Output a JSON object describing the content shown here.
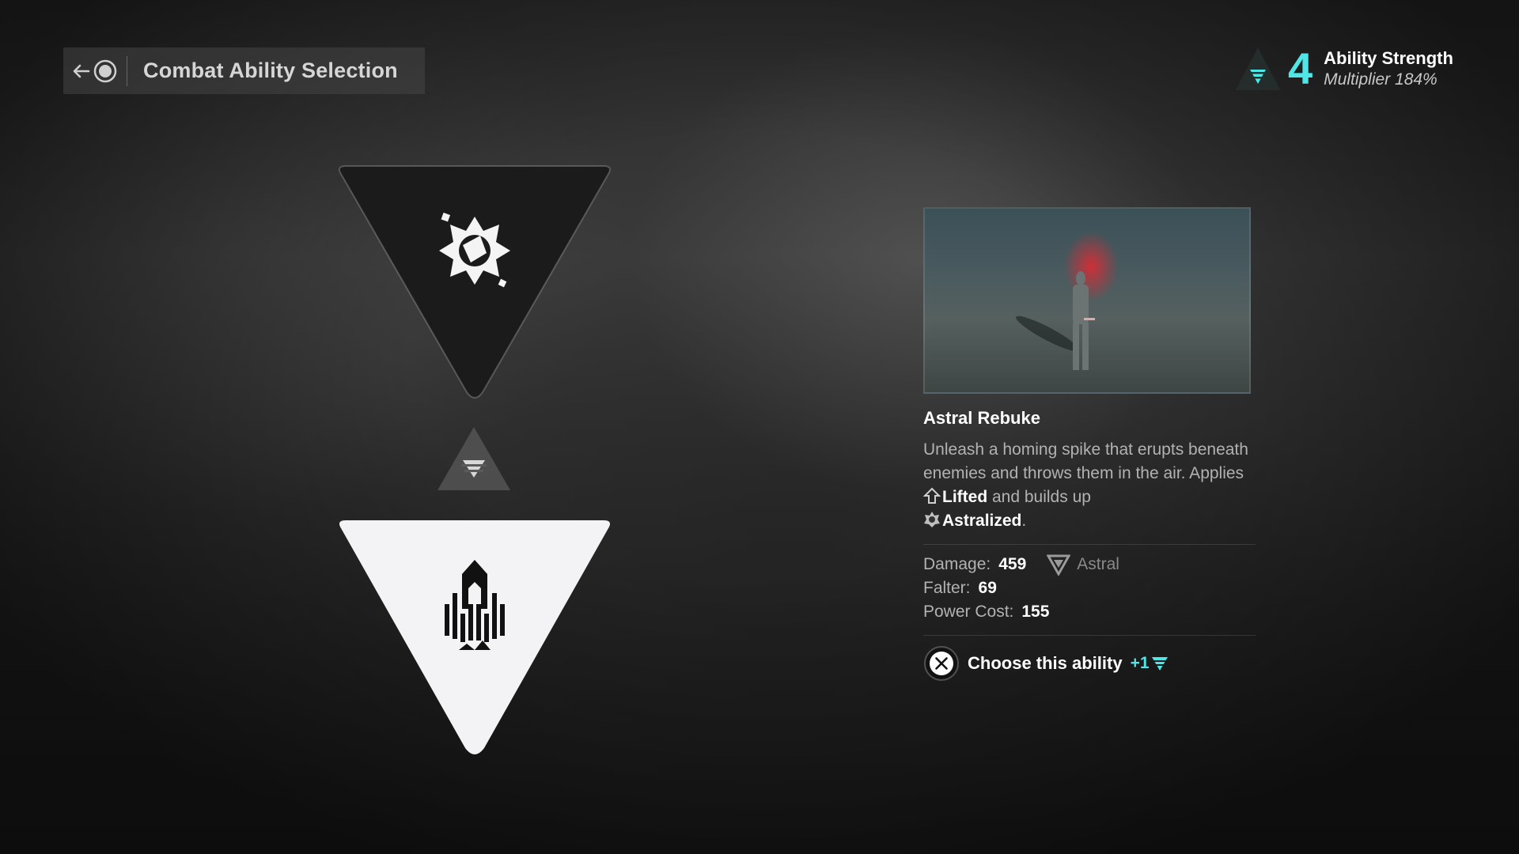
{
  "header": {
    "title": "Combat Ability Selection",
    "back_icon": "arrow-left-icon",
    "button_icon": "circle-button-icon"
  },
  "strength": {
    "value": "4",
    "label": "Ability Strength",
    "multiplier": "Multiplier 184%",
    "accent_color": "#4ee6e6"
  },
  "choices": [
    {
      "icon": "astral-sun-icon",
      "selected": false
    },
    {
      "icon": "rocket-spike-icon",
      "selected": true
    }
  ],
  "ability": {
    "name": "Astral Rebuke",
    "desc_part1": "Unleash a homing spike that erupts beneath enemies and throws them in the air. Applies ",
    "lifted": "Lifted",
    "desc_part2": " and builds up ",
    "astralized": "Astralized",
    "desc_end": ".",
    "stats": {
      "damage_label": "Damage:",
      "damage": "459",
      "element": "Astral",
      "falter_label": "Falter:",
      "falter": "69",
      "power_label": "Power Cost:",
      "power": "155"
    }
  },
  "action": {
    "label": "Choose this ability",
    "bonus": "+1",
    "button_icon": "cross-button-icon"
  }
}
